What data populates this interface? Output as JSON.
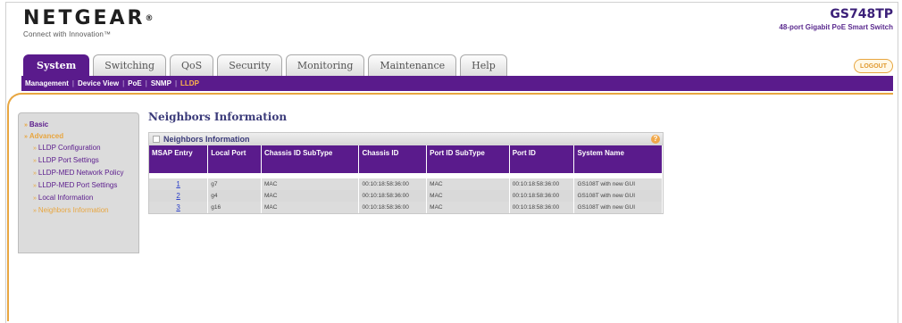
{
  "brand": {
    "logo": "NETGEAR",
    "tagline": "Connect with Innovation™"
  },
  "product": {
    "model": "GS748TP",
    "description": "48-port Gigabit PoE Smart Switch"
  },
  "tabs": [
    {
      "label": "System",
      "active": true
    },
    {
      "label": "Switching",
      "active": false
    },
    {
      "label": "QoS",
      "active": false
    },
    {
      "label": "Security",
      "active": false
    },
    {
      "label": "Monitoring",
      "active": false
    },
    {
      "label": "Maintenance",
      "active": false
    },
    {
      "label": "Help",
      "active": false
    }
  ],
  "logout_label": "LOGOUT",
  "subnav": [
    {
      "label": "Management",
      "current": false
    },
    {
      "label": "Device View",
      "current": false
    },
    {
      "label": "PoE",
      "current": false
    },
    {
      "label": "SNMP",
      "current": false
    },
    {
      "label": "LLDP",
      "current": true
    }
  ],
  "sidebar": {
    "basic": "Basic",
    "advanced": "Advanced",
    "items": [
      "LLDP Configuration",
      "LLDP Port Settings",
      "LLDP-MED Network Policy",
      "LLDP-MED Port Settings",
      "Local Information",
      "Neighbors Information"
    ]
  },
  "page_title": "Neighbors Information",
  "panel": {
    "title": "Neighbors Information",
    "help_icon": "?"
  },
  "table": {
    "columns": [
      "MSAP Entry",
      "Local Port",
      "Chassis ID SubType",
      "Chassis ID",
      "Port ID SubType",
      "Port ID",
      "System Name"
    ],
    "rows": [
      [
        "1",
        "g7",
        "MAC",
        "00:10:18:58:36:00",
        "MAC",
        "00:10:18:58:36:00",
        "GS108T with new GUI"
      ],
      [
        "2",
        "g4",
        "MAC",
        "00:10:18:58:36:00",
        "MAC",
        "00:10:18:58:36:00",
        "GS108T with new GUI"
      ],
      [
        "3",
        "g16",
        "MAC",
        "00:10:18:58:36:00",
        "MAC",
        "00:10:18:58:36:00",
        "GS108T with new GUI"
      ]
    ]
  },
  "colors": {
    "purple": "#5a1b8c",
    "orange": "#e8a640"
  }
}
